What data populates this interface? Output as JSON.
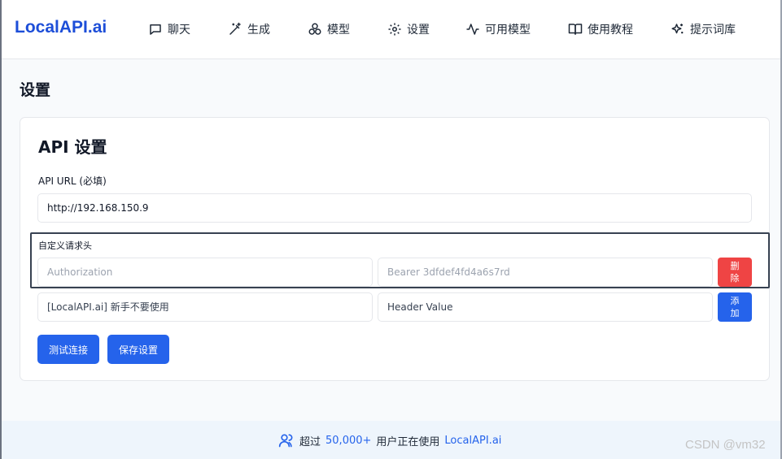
{
  "brand": "LocalAPI.ai",
  "nav": [
    {
      "label": "聊天",
      "icon": "chat-icon"
    },
    {
      "label": "生成",
      "icon": "magic-wand-icon"
    },
    {
      "label": "模型",
      "icon": "models-icon"
    },
    {
      "label": "设置",
      "icon": "gear-icon"
    },
    {
      "label": "可用模型",
      "icon": "activity-icon"
    },
    {
      "label": "使用教程",
      "icon": "book-icon"
    },
    {
      "label": "提示词库",
      "icon": "sparkles-icon"
    }
  ],
  "page_title": "设置",
  "api_card": {
    "title": "API 设置",
    "url_label": "API URL (必填)",
    "url_value": "http://192.168.150.9",
    "headers_label": "自定义请求头",
    "header_rows": [
      {
        "key_placeholder": "Authorization",
        "value_placeholder": "Bearer 3dfdef4fd4a6s7rd",
        "action": "删除",
        "action_color": "#ef4444"
      },
      {
        "key_placeholder": "[LocalAPI.ai] 新手不要使用",
        "value_placeholder": "Header Value",
        "action": "添加",
        "action_color": "#2563eb"
      }
    ],
    "test_button": "测试连接",
    "save_button": "保存设置"
  },
  "footer": {
    "prefix": "超过",
    "count": "50,000+",
    "middle": "用户正在使用",
    "link": "LocalAPI.ai",
    "icon": "users-icon"
  },
  "watermark": "CSDN @vm32",
  "colors": {
    "brand": "#1d4ed8",
    "primary": "#2563eb",
    "danger": "#ef4444",
    "footer_bg": "#eef5fc"
  }
}
